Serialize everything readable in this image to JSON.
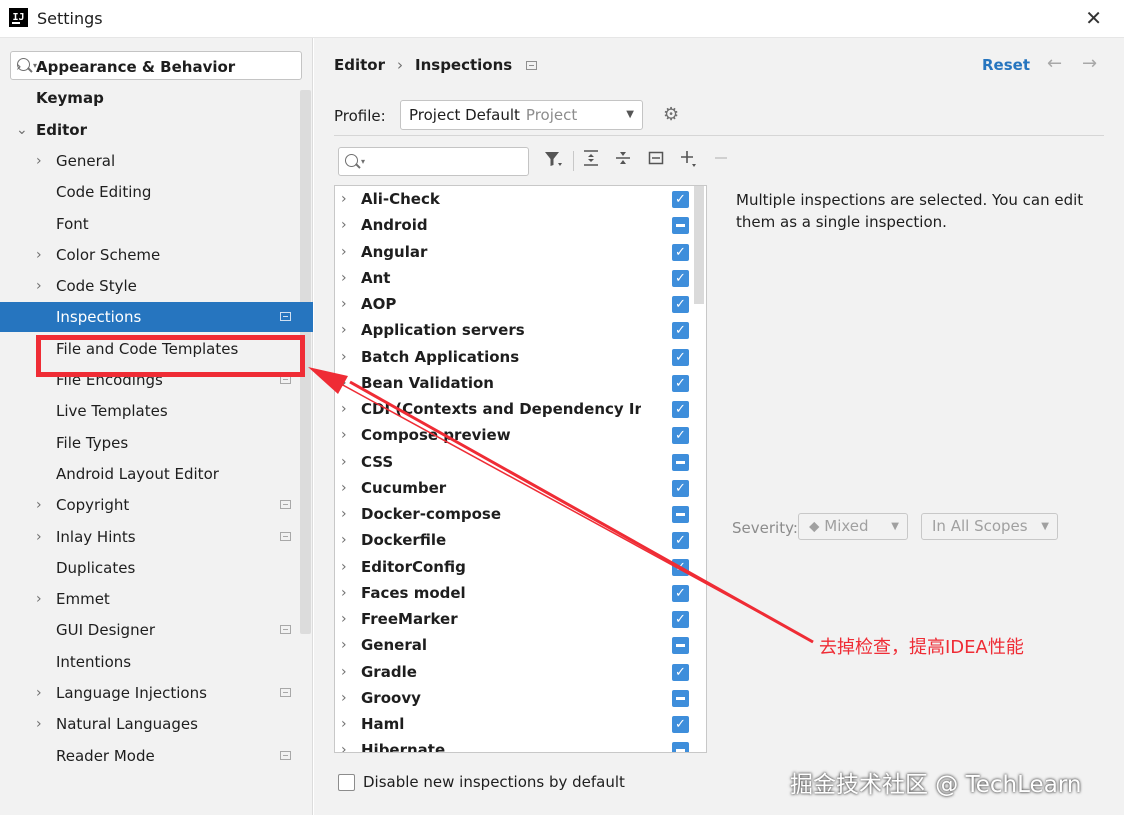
{
  "window": {
    "title": "Settings",
    "app_icon": "intellij-icon",
    "close_label": "✕"
  },
  "sidebar": {
    "search_placeholder": "",
    "items": [
      {
        "label": "Appearance & Behavior",
        "bold": true,
        "chevron": "›",
        "level": 0
      },
      {
        "label": "Keymap",
        "bold": true,
        "chevron": "",
        "level": 0
      },
      {
        "label": "Editor",
        "bold": true,
        "chevron": "⌄",
        "level": 0
      },
      {
        "label": "General",
        "chevron": "›",
        "level": 1
      },
      {
        "label": "Code Editing",
        "chevron": "",
        "level": 1
      },
      {
        "label": "Font",
        "chevron": "",
        "level": 1
      },
      {
        "label": "Color Scheme",
        "chevron": "›",
        "level": 1
      },
      {
        "label": "Code Style",
        "chevron": "›",
        "level": 1
      },
      {
        "label": "Inspections",
        "chevron": "",
        "level": 1,
        "selected": true,
        "project_icon": true
      },
      {
        "label": "File and Code Templates",
        "chevron": "",
        "level": 1
      },
      {
        "label": "File Encodings",
        "chevron": "",
        "level": 1,
        "project_icon": true
      },
      {
        "label": "Live Templates",
        "chevron": "",
        "level": 1
      },
      {
        "label": "File Types",
        "chevron": "",
        "level": 1
      },
      {
        "label": "Android Layout Editor",
        "chevron": "",
        "level": 1
      },
      {
        "label": "Copyright",
        "chevron": "›",
        "level": 1,
        "project_icon": true
      },
      {
        "label": "Inlay Hints",
        "chevron": "›",
        "level": 1,
        "project_icon": true
      },
      {
        "label": "Duplicates",
        "chevron": "",
        "level": 1
      },
      {
        "label": "Emmet",
        "chevron": "›",
        "level": 1
      },
      {
        "label": "GUI Designer",
        "chevron": "",
        "level": 1,
        "project_icon": true
      },
      {
        "label": "Intentions",
        "chevron": "",
        "level": 1
      },
      {
        "label": "Language Injections",
        "chevron": "›",
        "level": 1,
        "project_icon": true
      },
      {
        "label": "Natural Languages",
        "chevron": "›",
        "level": 1
      },
      {
        "label": "Reader Mode",
        "chevron": "",
        "level": 1,
        "project_icon": true
      }
    ]
  },
  "header": {
    "breadcrumb": [
      "Editor",
      "Inspections"
    ],
    "breadcrumb_sep": "›",
    "reset_label": "Reset",
    "back_arrow": "←",
    "forward_arrow": "→"
  },
  "profile": {
    "label": "Profile:",
    "value": "Project Default",
    "scope": "Project"
  },
  "toolbar": {
    "search_placeholder": "",
    "icons": [
      "filter-icon",
      "expand-all-icon",
      "collapse-all-icon",
      "reset-to-default-icon",
      "add-icon",
      "remove-icon"
    ]
  },
  "inspections": [
    {
      "name": "Ali-Check",
      "state": "checked"
    },
    {
      "name": "Android",
      "state": "mixed"
    },
    {
      "name": "Angular",
      "state": "checked"
    },
    {
      "name": "Ant",
      "state": "checked"
    },
    {
      "name": "AOP",
      "state": "checked"
    },
    {
      "name": "Application servers",
      "state": "checked"
    },
    {
      "name": "Batch Applications",
      "state": "checked"
    },
    {
      "name": "Bean Validation",
      "state": "checked"
    },
    {
      "name": "CDI (Contexts and Dependency Injection)",
      "state": "checked"
    },
    {
      "name": "Compose preview",
      "state": "checked"
    },
    {
      "name": "CSS",
      "state": "mixed"
    },
    {
      "name": "Cucumber",
      "state": "checked"
    },
    {
      "name": "Docker-compose",
      "state": "mixed"
    },
    {
      "name": "Dockerfile",
      "state": "checked"
    },
    {
      "name": "EditorConfig",
      "state": "checked"
    },
    {
      "name": "Faces model",
      "state": "checked"
    },
    {
      "name": "FreeMarker",
      "state": "checked"
    },
    {
      "name": "General",
      "state": "mixed"
    },
    {
      "name": "Gradle",
      "state": "checked"
    },
    {
      "name": "Groovy",
      "state": "mixed"
    },
    {
      "name": "Haml",
      "state": "checked"
    },
    {
      "name": "Hibernate",
      "state": "mixed"
    }
  ],
  "description": "Multiple inspections are selected. You can edit them as a single inspection.",
  "severity": {
    "label": "Severity:",
    "value": "Mixed",
    "scope": "In All Scopes"
  },
  "footer": {
    "disable_new_label": "Disable new inspections by default",
    "checked": false
  },
  "annotation": {
    "text": "去掉检查，提高IDEA性能",
    "color": "#ef2c35"
  },
  "watermark": "掘金技术社区 @ TechLearn",
  "colors": {
    "selection": "#2675bf",
    "checkbox": "#3e8edb",
    "link": "#2675bf",
    "annotation_red": "#ef2c35"
  }
}
